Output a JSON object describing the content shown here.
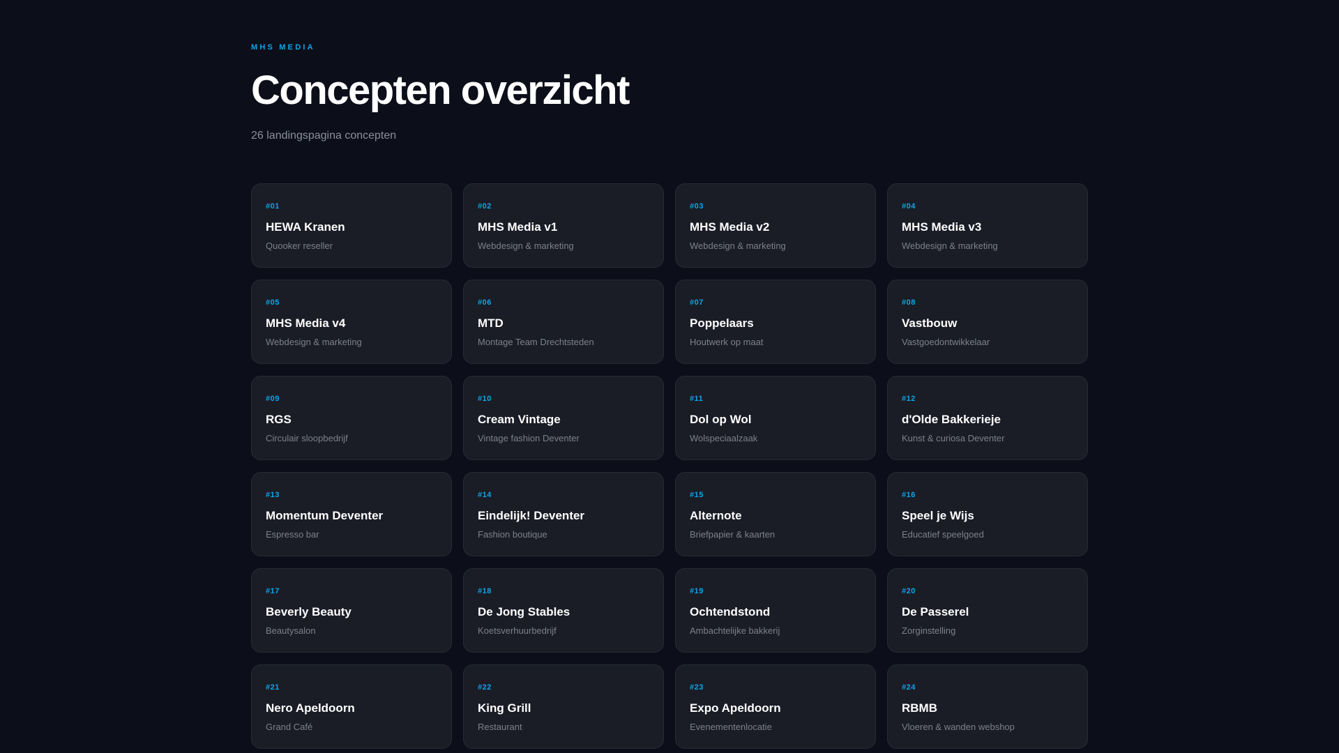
{
  "header": {
    "brand": "MHS MEDIA",
    "title": "Concepten overzicht",
    "subtitle": "26 landingspagina concepten"
  },
  "colors": {
    "background": "#0c0f1a",
    "card": "#1a1d26",
    "accent": "#0ea5e9"
  },
  "concepts": [
    {
      "num": "#01",
      "name": "HEWA Kranen",
      "desc": "Quooker reseller"
    },
    {
      "num": "#02",
      "name": "MHS Media v1",
      "desc": "Webdesign & marketing"
    },
    {
      "num": "#03",
      "name": "MHS Media v2",
      "desc": "Webdesign & marketing"
    },
    {
      "num": "#04",
      "name": "MHS Media v3",
      "desc": "Webdesign & marketing"
    },
    {
      "num": "#05",
      "name": "MHS Media v4",
      "desc": "Webdesign & marketing"
    },
    {
      "num": "#06",
      "name": "MTD",
      "desc": "Montage Team Drechtsteden"
    },
    {
      "num": "#07",
      "name": "Poppelaars",
      "desc": "Houtwerk op maat"
    },
    {
      "num": "#08",
      "name": "Vastbouw",
      "desc": "Vastgoedontwikkelaar"
    },
    {
      "num": "#09",
      "name": "RGS",
      "desc": "Circulair sloopbedrijf"
    },
    {
      "num": "#10",
      "name": "Cream Vintage",
      "desc": "Vintage fashion Deventer"
    },
    {
      "num": "#11",
      "name": "Dol op Wol",
      "desc": "Wolspeciaalzaak"
    },
    {
      "num": "#12",
      "name": "d'Olde Bakkerieje",
      "desc": "Kunst & curiosa Deventer"
    },
    {
      "num": "#13",
      "name": "Momentum Deventer",
      "desc": "Espresso bar"
    },
    {
      "num": "#14",
      "name": "Eindelijk! Deventer",
      "desc": "Fashion boutique"
    },
    {
      "num": "#15",
      "name": "Alternote",
      "desc": "Briefpapier & kaarten"
    },
    {
      "num": "#16",
      "name": "Speel je Wijs",
      "desc": "Educatief speelgoed"
    },
    {
      "num": "#17",
      "name": "Beverly Beauty",
      "desc": "Beautysalon"
    },
    {
      "num": "#18",
      "name": "De Jong Stables",
      "desc": "Koetsverhuurbedrijf"
    },
    {
      "num": "#19",
      "name": "Ochtendstond",
      "desc": "Ambachtelijke bakkerij"
    },
    {
      "num": "#20",
      "name": "De Passerel",
      "desc": "Zorginstelling"
    },
    {
      "num": "#21",
      "name": "Nero Apeldoorn",
      "desc": "Grand Café"
    },
    {
      "num": "#22",
      "name": "King Grill",
      "desc": "Restaurant"
    },
    {
      "num": "#23",
      "name": "Expo Apeldoorn",
      "desc": "Evenementenlocatie"
    },
    {
      "num": "#24",
      "name": "RBMB",
      "desc": "Vloeren & wanden webshop"
    }
  ]
}
